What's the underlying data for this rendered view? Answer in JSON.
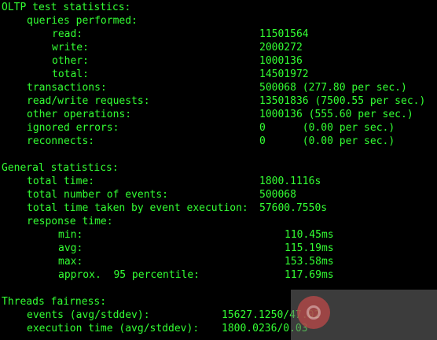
{
  "colors": {
    "background": "#000000",
    "text": "#33ff33"
  },
  "oltp": {
    "heading": "OLTP test statistics:",
    "queries_heading": "queries performed:",
    "read_label": "read:",
    "read_value": "11501564",
    "write_label": "write:",
    "write_value": "2000272",
    "other_label": "other:",
    "other_value": "1000136",
    "total_label": "total:",
    "total_value": "14501972",
    "transactions_label": "transactions:",
    "transactions_value": "500068 (277.80 per sec.)",
    "rw_label": "read/write requests:",
    "rw_value": "13501836 (7500.55 per sec.)",
    "otherops_label": "other operations:",
    "otherops_value": "1000136 (555.60 per sec.)",
    "ignored_label": "ignored errors:",
    "ignored_value": "0      (0.00 per sec.)",
    "reconnects_label": "reconnects:",
    "reconnects_value": "0      (0.00 per sec.)"
  },
  "general": {
    "heading": "General statistics:",
    "total_time_label": "total time:",
    "total_time_value": "1800.1116s",
    "events_label": "total number of events:",
    "events_value": "500068",
    "exec_label": "total time taken by event execution:",
    "exec_value": "57600.7550s",
    "response_heading": "response time:",
    "min_label": "min:",
    "min_value": "110.45ms",
    "avg_label": "avg:",
    "avg_value": "115.19ms",
    "max_label": "max:",
    "max_value": "153.58ms",
    "pct_label": "approx.  95 percentile:",
    "pct_value": "117.69ms"
  },
  "threads": {
    "heading": "Threads fairness:",
    "events_label": "events (avg/stddev):",
    "events_value": "15627.1250/47.02",
    "exec_label": "execution time (avg/stddev):",
    "exec_value": "1800.0236/0.03"
  },
  "watermark": {
    "icon": "logo-icon"
  }
}
